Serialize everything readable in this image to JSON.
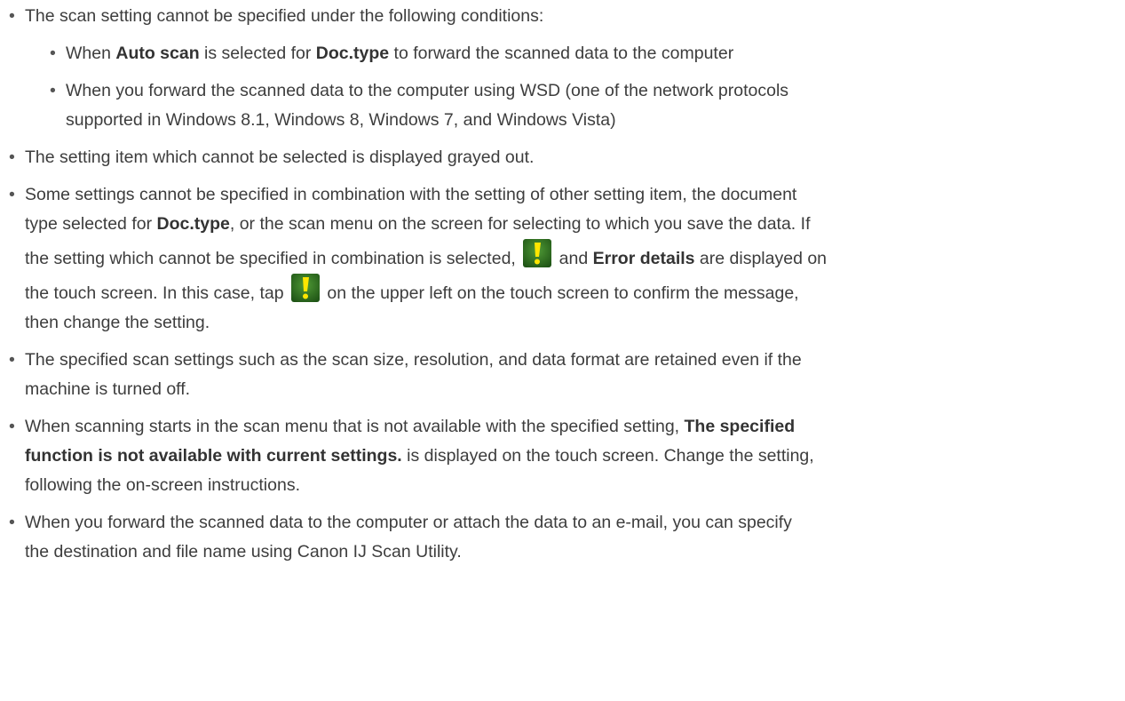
{
  "notes": {
    "item1": {
      "text": "The scan setting cannot be specified under the following conditions:",
      "sub1": {
        "t1": "When ",
        "b1": "Auto scan",
        "t2": " is selected for ",
        "b2": "Doc.type",
        "t3": " to forward the scanned data to the computer"
      },
      "sub2": {
        "line1": "When you forward the scanned data to the computer using WSD (one of the network protocols",
        "line2": "supported in Windows 8.1, Windows 8, Windows 7, and Windows Vista)"
      }
    },
    "item2": {
      "text": "The setting item which cannot be selected is displayed grayed out."
    },
    "item3": {
      "line1": "Some settings cannot be specified in combination with the setting of other setting item, the document",
      "l2a": "type selected for ",
      "l2b": "Doc.type",
      "l2c": ", or the scan menu on the screen for selecting to which you save the data. If",
      "l3a": "the setting which cannot be specified in combination is selected, ",
      "l3b": " and ",
      "l3c": "Error details",
      "l3d": " are displayed on",
      "l4a": "the touch screen. In this case, tap ",
      "l4b": " on the upper left on the touch screen to confirm the message,",
      "line5": "then change the setting.",
      "icon": "warning-exclamation-icon",
      "icon_colors": {
        "background": "#2b6b1e",
        "glyph": "#ffe600"
      }
    },
    "item4": {
      "line1": "The specified scan settings such as the scan size, resolution, and data format are retained even if the",
      "line2": "machine is turned off."
    },
    "item5": {
      "l1a": "When scanning starts in the scan menu that is not available with the specified setting, ",
      "l1b": "The specified",
      "l2a": "function is not available with current settings.",
      "l2b": " is displayed on the touch screen. Change the setting,",
      "line3": "following the on-screen instructions."
    },
    "item6": {
      "line1": "When you forward the scanned data to the computer or attach the data to an e-mail, you can specify",
      "line2": "the destination and file name using Canon IJ Scan Utility."
    }
  }
}
